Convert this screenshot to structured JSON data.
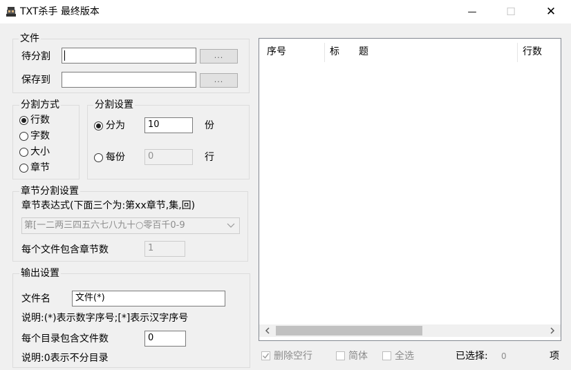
{
  "window": {
    "title": "TXT杀手 最终版本",
    "minimize_glyph": "—",
    "maximize_glyph": "☐",
    "close_glyph": "✕"
  },
  "file_group": {
    "legend": "文件",
    "split_label": "待分割",
    "split_value": "",
    "save_label": "保存到",
    "save_value": "",
    "browse_label": "...",
    "browse2_label": "..."
  },
  "split_mode": {
    "legend": "分割方式",
    "options": [
      "行数",
      "字数",
      "大小",
      "章节"
    ],
    "selected": "行数"
  },
  "split_settings": {
    "legend": "分割设置",
    "divide_label": "分为",
    "divide_value": "10",
    "divide_unit": "份",
    "each_label": "每份",
    "each_value": "0",
    "each_unit": "行"
  },
  "chapter": {
    "legend": "章节分割设置",
    "expr_label": "章节表达式(下面三个为:第xx章节,集,回)",
    "expr_value": "第[一二两三四五六七八九十○零百千0-9",
    "per_file_label": "每个文件包含章节数",
    "per_file_value": "1"
  },
  "output": {
    "legend": "输出设置",
    "filename_label": "文件名",
    "filename_value": "文件(*)",
    "note1": "说明:(*)表示数字序号;[*]表示汉字序号",
    "per_dir_label": "每个目录包含文件数",
    "per_dir_value": "0",
    "note2": "说明:0表示不分目录"
  },
  "list": {
    "columns": [
      "序号",
      "标　　题",
      "行数"
    ]
  },
  "bottom": {
    "delete_empty_label": "删除空行",
    "delete_empty_checked": true,
    "simplified_label": "简体",
    "select_all_label": "全选",
    "selected_label": "已选择:",
    "selected_count": "0",
    "item_unit": "项"
  }
}
